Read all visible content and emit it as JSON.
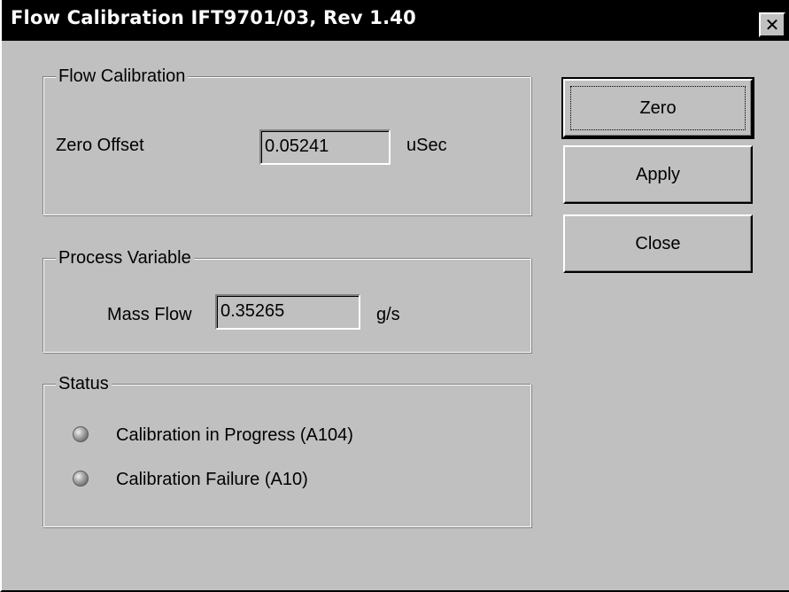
{
  "window": {
    "title": "Flow Calibration IFT9701/03, Rev 1.40",
    "close_glyph": "✕"
  },
  "flow_calibration": {
    "legend": "Flow Calibration",
    "zero_offset_label": "Zero Offset",
    "zero_offset_value": "0.05241",
    "zero_offset_unit": "uSec"
  },
  "process_variable": {
    "legend": "Process Variable",
    "mass_flow_label": "Mass Flow",
    "mass_flow_value": "0.35265",
    "mass_flow_unit": "g/s"
  },
  "status": {
    "legend": "Status",
    "items": [
      {
        "label": "Calibration in Progress (A104)",
        "icon": "status-led-icon"
      },
      {
        "label": "Calibration Failure (A10)",
        "icon": "status-led-icon"
      }
    ]
  },
  "buttons": {
    "zero": "Zero",
    "apply": "Apply",
    "close": "Close"
  }
}
